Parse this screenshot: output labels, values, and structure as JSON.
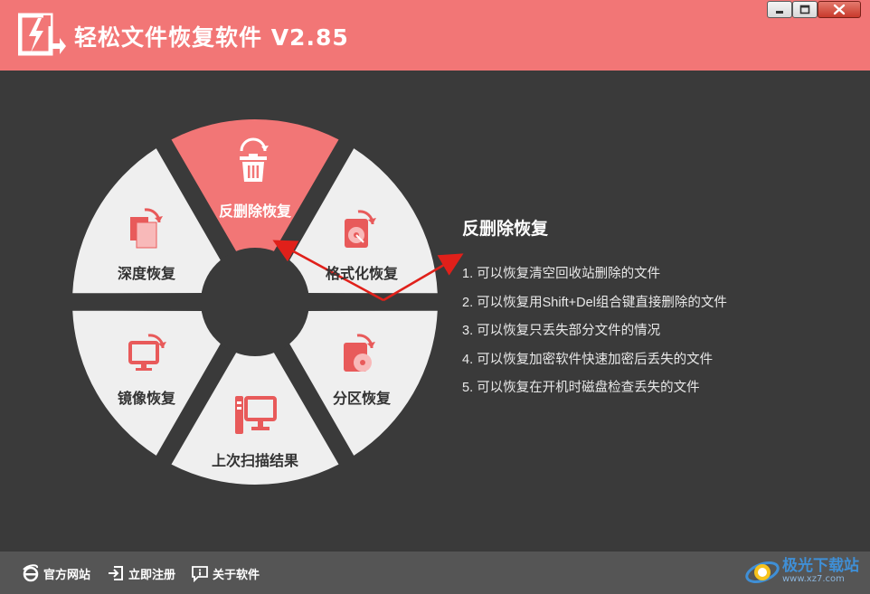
{
  "app": {
    "title": "轻松文件恢复软件 V2.85"
  },
  "window_controls": [
    "minimize-icon",
    "maximize-icon",
    "close-icon"
  ],
  "wheel": {
    "segments": [
      {
        "label": "反删除恢复",
        "icon": "trash-restore-icon",
        "active": true
      },
      {
        "label": "格式化恢复",
        "icon": "disk-restore-icon",
        "active": false
      },
      {
        "label": "分区恢复",
        "icon": "partition-restore-icon",
        "active": false
      },
      {
        "label": "上次扫描结果",
        "icon": "last-scan-icon",
        "active": false
      },
      {
        "label": "镜像恢复",
        "icon": "image-restore-icon",
        "active": false
      },
      {
        "label": "深度恢复",
        "icon": "deep-restore-icon",
        "active": false
      }
    ]
  },
  "info": {
    "title": "反删除恢复",
    "items": [
      "1. 可以恢复清空回收站删除的文件",
      "2. 可以恢复用Shift+Del组合键直接删除的文件",
      "3. 可以恢复只丢失部分文件的情况",
      "4. 可以恢复加密软件快速加密后丢失的文件",
      "5. 可以恢复在开机时磁盘检查丢失的文件"
    ]
  },
  "footer": {
    "links": [
      {
        "label": "官方网站",
        "icon": "ie-icon"
      },
      {
        "label": "立即注册",
        "icon": "register-icon"
      },
      {
        "label": "关于软件",
        "icon": "info-icon"
      }
    ],
    "watermark": {
      "text": "极光下载站",
      "url": "www.xz7.com"
    }
  },
  "colors": {
    "accent": "#f27676",
    "background": "#3a3a3a",
    "segment_fill": "#efefef",
    "footer": "#555555",
    "arrow": "#e0201a"
  }
}
